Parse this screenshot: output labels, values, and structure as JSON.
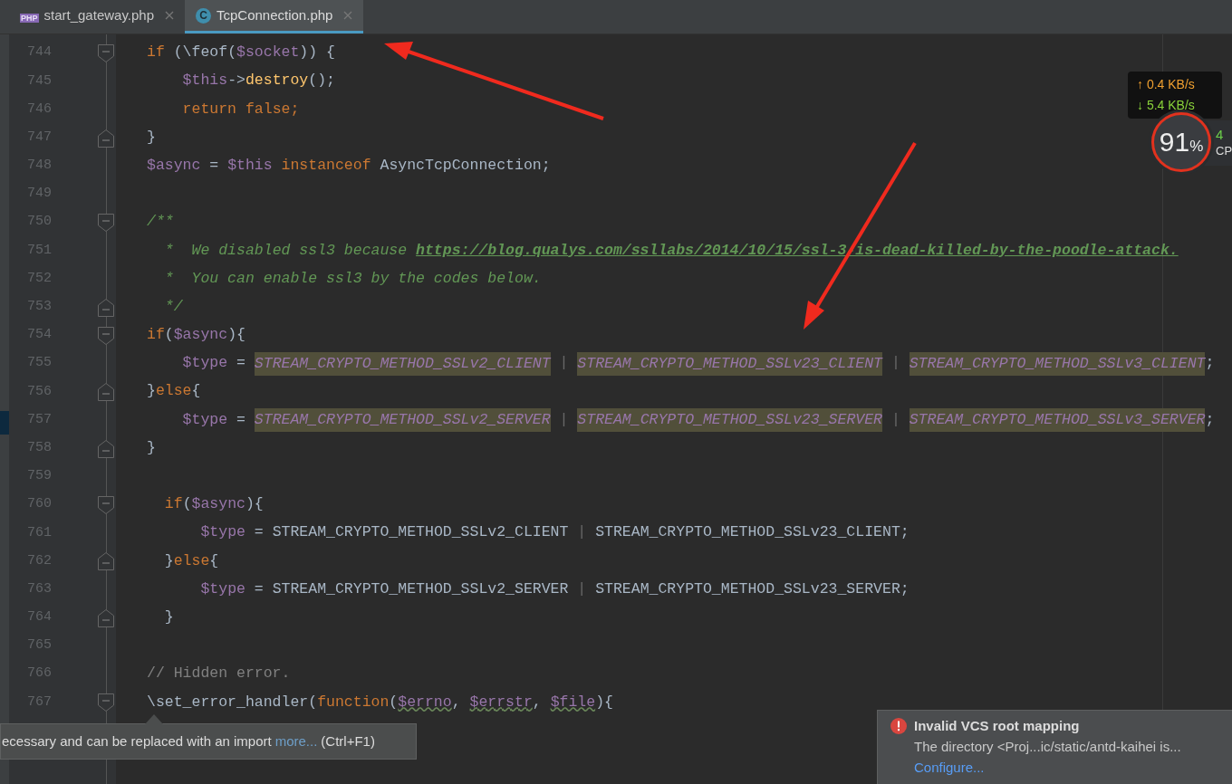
{
  "tabs": [
    {
      "label": "start_gateway.php",
      "kind": "php",
      "icon_label": "PHP",
      "selected": false
    },
    {
      "label": "TcpConnection.php",
      "kind": "class",
      "icon_label": "C",
      "selected": true
    }
  ],
  "editor": {
    "lines": [
      {
        "number": "744",
        "kind": "fold-start",
        "tokens": [
          {
            "kind": "kw",
            "text": "if "
          },
          {
            "kind": "plain",
            "text": "(\\feof("
          },
          {
            "kind": "var",
            "text": "$socket"
          },
          {
            "kind": "plain",
            "text": ")) {"
          }
        ]
      },
      {
        "number": "745",
        "kind": "code",
        "tokens": [
          {
            "kind": "var",
            "text": "    $this"
          },
          {
            "kind": "plain",
            "text": "->"
          },
          {
            "kind": "fn",
            "text": "destroy"
          },
          {
            "kind": "plain",
            "text": "();"
          }
        ]
      },
      {
        "number": "746",
        "kind": "code",
        "tokens": [
          {
            "kind": "kw",
            "text": "    return false;"
          }
        ]
      },
      {
        "number": "747",
        "kind": "fold-end",
        "tokens": [
          {
            "kind": "plain",
            "text": "}"
          }
        ]
      },
      {
        "number": "748",
        "kind": "code",
        "tokens": [
          {
            "kind": "var",
            "text": "$async"
          },
          {
            "kind": "plain",
            "text": " = "
          },
          {
            "kind": "var",
            "text": "$this"
          },
          {
            "kind": "kw",
            "text": " instanceof "
          },
          {
            "kind": "plain",
            "text": "AsyncTcpConnection;"
          }
        ]
      },
      {
        "number": "749",
        "kind": "code"
      },
      {
        "number": "750",
        "kind": "fold-start",
        "tokens": [
          {
            "kind": "doc",
            "text": "/**"
          }
        ]
      },
      {
        "number": "751",
        "kind": "code",
        "tokens": [
          {
            "kind": "doc",
            "text": "  *  We disabled ssl3 because "
          },
          {
            "kind": "link",
            "text": "https://blog.qualys.com/ssllabs/2014/10/15/ssl-3-is-dead-killed-by-the-poodle-attack."
          }
        ]
      },
      {
        "number": "752",
        "kind": "code",
        "tokens": [
          {
            "kind": "doc",
            "text": "  *  You can enable ssl3 by the codes below."
          }
        ]
      },
      {
        "number": "753",
        "kind": "fold-end",
        "tokens": [
          {
            "kind": "doc",
            "text": "  */"
          }
        ]
      },
      {
        "number": "754",
        "kind": "fold-start",
        "tokens": [
          {
            "kind": "kw",
            "text": "if"
          },
          {
            "kind": "plain",
            "text": "("
          },
          {
            "kind": "var",
            "text": "$async"
          },
          {
            "kind": "plain",
            "text": "){"
          }
        ]
      },
      {
        "number": "755",
        "kind": "code",
        "tokens": [
          {
            "kind": "var",
            "text": "    $type"
          },
          {
            "kind": "plain",
            "text": " = "
          },
          {
            "kind": "const",
            "text": "STREAM_CRYPTO_METHOD_SSLv2_CLIENT"
          },
          {
            "kind": "pipe",
            "text": " | "
          },
          {
            "kind": "const",
            "text": "STREAM_CRYPTO_METHOD_SSLv23_CLIENT"
          },
          {
            "kind": "pipe",
            "text": " | "
          },
          {
            "kind": "const",
            "text": "STREAM_CRYPTO_METHOD_SSLv3_CLIENT"
          },
          {
            "kind": "plain",
            "text": ";"
          }
        ]
      },
      {
        "number": "756",
        "kind": "fold-end",
        "tokens": [
          {
            "kind": "plain",
            "text": "}"
          },
          {
            "kind": "kw",
            "text": "else"
          },
          {
            "kind": "plain",
            "text": "{"
          }
        ]
      },
      {
        "number": "757",
        "kind": "code",
        "tokens": [
          {
            "kind": "var",
            "text": "    $type"
          },
          {
            "kind": "plain",
            "text": " = "
          },
          {
            "kind": "const",
            "text": "STREAM_CRYPTO_METHOD_SSLv2_SERVER"
          },
          {
            "kind": "pipe",
            "text": " | "
          },
          {
            "kind": "const",
            "text": "STREAM_CRYPTO_METHOD_SSLv23_SERVER"
          },
          {
            "kind": "pipe",
            "text": " | "
          },
          {
            "kind": "const",
            "text": "STREAM_CRYPTO_METHOD_SSLv3_SERVER"
          },
          {
            "kind": "plain",
            "text": ";"
          }
        ]
      },
      {
        "number": "758",
        "kind": "fold-end",
        "tokens": [
          {
            "kind": "plain",
            "text": "}"
          }
        ]
      },
      {
        "number": "759",
        "kind": "code"
      },
      {
        "number": "760",
        "kind": "fold-start",
        "tokens": [
          {
            "kind": "kw",
            "text": "  if"
          },
          {
            "kind": "plain",
            "text": "("
          },
          {
            "kind": "var",
            "text": "$async"
          },
          {
            "kind": "plain",
            "text": "){"
          }
        ]
      },
      {
        "number": "761",
        "kind": "code",
        "tokens": [
          {
            "kind": "var",
            "text": "      $type"
          },
          {
            "kind": "plain",
            "text": " = STREAM_CRYPTO_METHOD_SSLv2_CLIENT"
          },
          {
            "kind": "pipe",
            "text": " | "
          },
          {
            "kind": "plain",
            "text": "STREAM_CRYPTO_METHOD_SSLv23_CLIENT;"
          }
        ]
      },
      {
        "number": "762",
        "kind": "fold-end",
        "tokens": [
          {
            "kind": "plain",
            "text": "  }"
          },
          {
            "kind": "kw",
            "text": "else"
          },
          {
            "kind": "plain",
            "text": "{"
          }
        ]
      },
      {
        "number": "763",
        "kind": "code",
        "tokens": [
          {
            "kind": "var",
            "text": "      $type"
          },
          {
            "kind": "plain",
            "text": " = STREAM_CRYPTO_METHOD_SSLv2_SERVER"
          },
          {
            "kind": "pipe",
            "text": " | "
          },
          {
            "kind": "plain",
            "text": "STREAM_CRYPTO_METHOD_SSLv23_SERVER;"
          }
        ]
      },
      {
        "number": "764",
        "kind": "fold-end",
        "tokens": [
          {
            "kind": "plain",
            "text": "  }"
          }
        ]
      },
      {
        "number": "765",
        "kind": "code"
      },
      {
        "number": "766",
        "kind": "code",
        "tokens": [
          {
            "kind": "comment",
            "text": "// Hidden error."
          }
        ]
      },
      {
        "number": "767",
        "kind": "fold-start",
        "tokens": [
          {
            "kind": "plain",
            "text": "\\set_error_handler("
          },
          {
            "kind": "kw",
            "text": "function"
          },
          {
            "kind": "plain",
            "text": "("
          },
          {
            "kind": "warn",
            "text": "$errno"
          },
          {
            "kind": "plain",
            "text": ", "
          },
          {
            "kind": "warn",
            "text": "$errstr"
          },
          {
            "kind": "plain",
            "text": ", "
          },
          {
            "kind": "warn",
            "text": "$file"
          },
          {
            "kind": "plain",
            "text": "){"
          }
        ]
      }
    ]
  },
  "network": {
    "upload": "↑ 0.4 KB/s",
    "download": "↓ 5.4 KB/s"
  },
  "cpu": {
    "percent": "91",
    "unit": "%",
    "side_value": "4",
    "side_label": "CP"
  },
  "tooltip": {
    "text": "ecessary and can be replaced with an import",
    "link": "more...",
    "shortcut": "(Ctrl+F1)"
  },
  "notification": {
    "title": "Invalid VCS root mapping",
    "body": "The directory <Proj...ic/static/antd-kaihei is...",
    "link": "Configure..."
  }
}
